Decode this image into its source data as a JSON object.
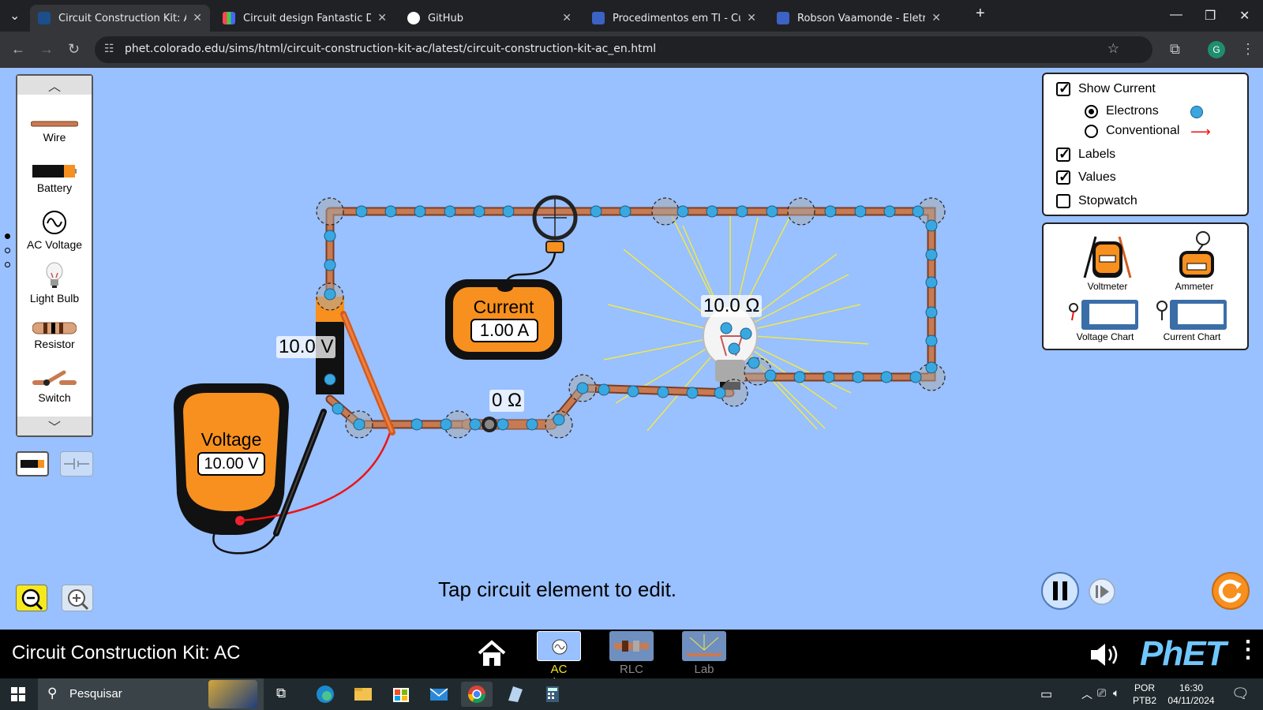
{
  "browser": {
    "tabs": [
      {
        "title": "Circuit Construction Kit: AC",
        "active": true
      },
      {
        "title": "Circuit design Fantastic Densor",
        "active": false
      },
      {
        "title": "GitHub",
        "active": false
      },
      {
        "title": "Procedimentos em TI - Cursos T",
        "active": false
      },
      {
        "title": "Robson Vaamonde - Eletricidad",
        "active": false
      }
    ],
    "new_tab": "+",
    "url": "phet.colorado.edu/sims/html/circuit-construction-kit-ac/latest/circuit-construction-kit-ac_en.html",
    "profile_initial": "G"
  },
  "toolbox": {
    "items": [
      {
        "label": "Wire",
        "icon": "wire-icon"
      },
      {
        "label": "Battery",
        "icon": "battery-icon"
      },
      {
        "label": "AC Voltage",
        "icon": "ac-voltage-icon"
      },
      {
        "label": "Light Bulb",
        "icon": "light-bulb-icon"
      },
      {
        "label": "Resistor",
        "icon": "resistor-icon"
      },
      {
        "label": "Switch",
        "icon": "switch-icon"
      }
    ]
  },
  "options_panel": {
    "show_current": {
      "label": "Show Current",
      "checked": true
    },
    "electrons": {
      "label": "Electrons",
      "selected": true
    },
    "conventional": {
      "label": "Conventional",
      "selected": false
    },
    "labels": {
      "label": "Labels",
      "checked": true
    },
    "values": {
      "label": "Values",
      "checked": true
    },
    "stopwatch": {
      "label": "Stopwatch",
      "checked": false
    }
  },
  "sensors_panel": {
    "voltmeter": "Voltmeter",
    "ammeter": "Ammeter",
    "voltage_chart": "Voltage Chart",
    "current_chart": "Current Chart",
    "voltmeter_screen": "Voltage",
    "ammeter_screen": "Current"
  },
  "circuit": {
    "battery_label": "10.0 V",
    "bulb_label": "10.0 Ω",
    "switch_label": "0 Ω",
    "ammeter": {
      "title": "Current",
      "value": "1.00 A"
    },
    "voltmeter": {
      "title": "Voltage",
      "value": "10.00 V"
    }
  },
  "hint": "Tap circuit element to edit.",
  "navbar": {
    "sim_title": "Circuit Construction Kit: AC",
    "screens": [
      {
        "label": "AC Voltage",
        "active": true
      },
      {
        "label": "RLC",
        "active": false
      },
      {
        "label": "Lab",
        "active": false
      }
    ],
    "brand": "PhET"
  },
  "taskbar": {
    "search_placeholder": "Pesquisar",
    "lang_top": "POR",
    "lang_bottom": "PTB2",
    "time": "16:30",
    "date": "04/11/2024"
  },
  "colors": {
    "sim_bg": "#99c0ff",
    "wire": "#c87a52",
    "electron": "#3aa8e0",
    "meter_body": "#f7901e",
    "accent_yellow": "#f0e84a"
  }
}
